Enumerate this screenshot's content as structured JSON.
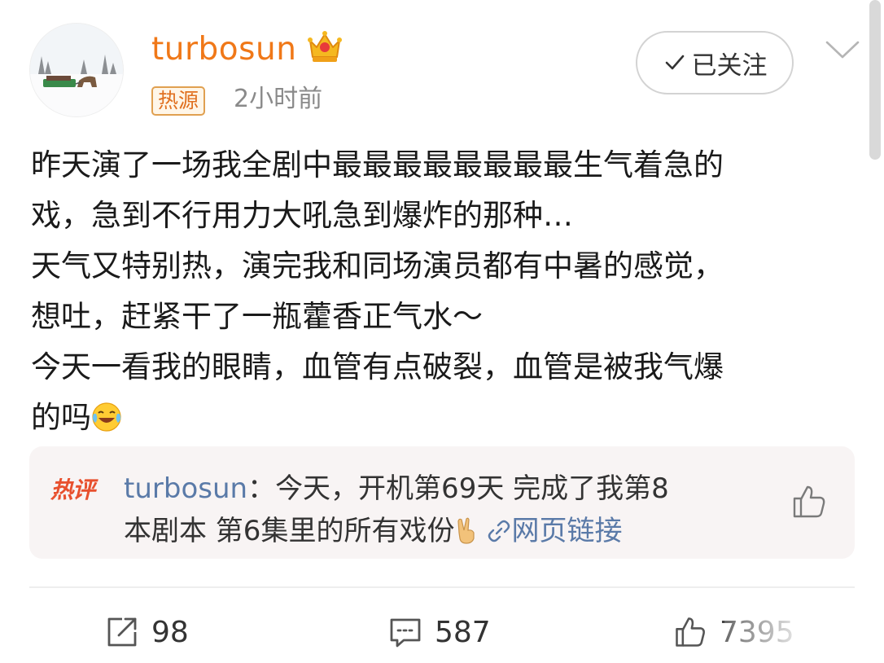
{
  "post": {
    "username": "turbosun",
    "tag": "热源",
    "time": "2小时前",
    "follow_label": "已关注",
    "content_lines": [
      "昨天演了一场我全剧中最最最最最最最最生气着急的",
      "戏，急到不行用力大吼急到爆炸的那种…",
      "天气又特别热，演完我和同场演员都有中暑的感觉，",
      "想吐，赶紧干了一瓶藿香正气水～",
      "今天一看我的眼睛，血管有点破裂，血管是被我气爆",
      "的吗"
    ]
  },
  "hot_comment": {
    "label": "热评",
    "author": "turbosun",
    "separator": "：",
    "text_line1": "今天，开机第69天 完成了我第8",
    "text_line2": "本剧本 第6集里的所有戏份",
    "link_label": "网页链接"
  },
  "actions": {
    "repost_count": "98",
    "comment_count": "587",
    "like_count": "7395"
  },
  "icons": {
    "crown": "crown-icon",
    "check": "check-icon",
    "chevron": "chevron-down-icon",
    "emoji": "laugh-cry-emoji-icon",
    "victory": "victory-hand-icon",
    "link": "link-icon",
    "thumbs_up": "thumbs-up-icon",
    "repost": "repost-icon",
    "comment": "comment-icon"
  },
  "colors": {
    "username": "#f07818",
    "hot_label": "#e8502e",
    "link": "#5a7aa8",
    "time": "#8a8a8a"
  }
}
